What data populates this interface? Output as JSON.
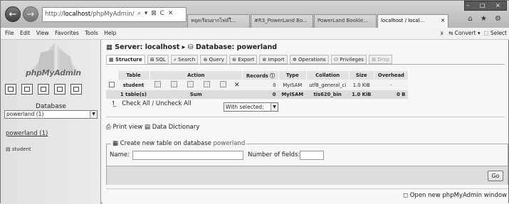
{
  "browser": {
    "url_prefix": "http://",
    "url_host": "localhost",
    "url_path": "/phpMyAdmin/",
    "address_icons": "⌕ ▾ ⊠ C ✕",
    "tabs": [
      {
        "label": "หยุดเรียนยากไฟล์ไี..."
      },
      {
        "label": "#R3_PowerLand Bo..."
      },
      {
        "label": "PowerLand Bookle..."
      },
      {
        "label": "localhost / local..."
      }
    ],
    "window_controls": "– □ ×",
    "right_icons": "⌂ ★ ⚙"
  },
  "menubar": {
    "items": [
      "File",
      "Edit",
      "View",
      "Favorites",
      "Tools",
      "Help"
    ],
    "close_x": "x",
    "convert": "Convert ▾",
    "select": "Select"
  },
  "nav": {
    "logo": "phpMyAdmin",
    "database_label": "Database",
    "db_select": "powerland (1)",
    "db_link": "powerland (1)",
    "table_link": "student"
  },
  "main": {
    "server": "Server: localhost",
    "separator": "▸",
    "database": "Database: powerland",
    "tabs": [
      {
        "label": "Structure",
        "icon": "structure-icon",
        "selected": true
      },
      {
        "label": "SQL",
        "icon": "sql-icon"
      },
      {
        "label": "Search",
        "icon": "search-icon"
      },
      {
        "label": "Query",
        "icon": "query-icon"
      },
      {
        "label": "Export",
        "icon": "export-icon"
      },
      {
        "label": "Import",
        "icon": "import-icon"
      },
      {
        "label": "Operations",
        "icon": "operations-icon"
      },
      {
        "label": "Privileges",
        "icon": "privileges-icon"
      },
      {
        "label": "Drop",
        "icon": "drop-icon",
        "dim": true
      }
    ],
    "table": {
      "headers": [
        "Table",
        "Action",
        "Records",
        "Type",
        "Collation",
        "Size",
        "Overhead"
      ],
      "row": {
        "table": "student",
        "records": "0",
        "type": "MyISAM",
        "collation": "utf8_general_ci",
        "size": "1.0 KiB",
        "overhead": "-"
      },
      "sum_row": {
        "table": "1 table(s)",
        "action": "Sum",
        "records": "0",
        "type": "MyISAM",
        "collation": "tis620_bin",
        "size": "1.0 KiB",
        "overhead": "0 B"
      }
    },
    "check_all": "Check All / Uncheck All",
    "with_selected": "With selected:",
    "print_view": "Print view",
    "data_dictionary": "Data Dictionary",
    "create_legend": "Create new table on database",
    "create_db": "powerland",
    "name_label": "Name:",
    "fields_label": "Number of fields:",
    "go": "Go",
    "open_window": "Open new phpMyAdmin window"
  }
}
